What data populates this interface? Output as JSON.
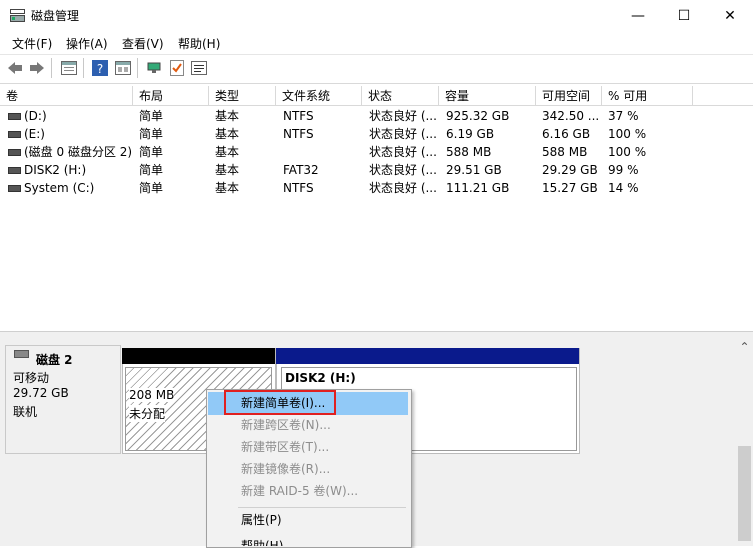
{
  "window": {
    "title": "磁盘管理",
    "minimize": "—",
    "maximize": "☐",
    "close": "✕"
  },
  "menubar": [
    "文件(F)",
    "操作(A)",
    "查看(V)",
    "帮助(H)"
  ],
  "toolbar": [
    "back-icon",
    "forward-icon",
    "panel-icon",
    "help-icon",
    "properties-icon",
    "connect-icon",
    "check-icon",
    "list-icon"
  ],
  "table": {
    "columns": [
      "卷",
      "布局",
      "类型",
      "文件系统",
      "状态",
      "容量",
      "可用空间",
      "% 可用"
    ],
    "rows": [
      [
        "(D:)",
        "简单",
        "基本",
        "NTFS",
        "状态良好 (...",
        "925.32 GB",
        "342.50 ...",
        "37 %"
      ],
      [
        "(E:)",
        "简单",
        "基本",
        "NTFS",
        "状态良好 (...",
        "6.19 GB",
        "6.16 GB",
        "100 %"
      ],
      [
        "(磁盘 0 磁盘分区 2)",
        "简单",
        "基本",
        "",
        "状态良好 (...",
        "588 MB",
        "588 MB",
        "100 %"
      ],
      [
        "DISK2 (H:)",
        "简单",
        "基本",
        "FAT32",
        "状态良好 (...",
        "29.51 GB",
        "29.29 GB",
        "99 %"
      ],
      [
        "System (C:)",
        "简单",
        "基本",
        "NTFS",
        "状态良好 (...",
        "111.21 GB",
        "15.27 GB",
        "14 %"
      ]
    ]
  },
  "disk": {
    "name": "磁盘 2",
    "type": "可移动",
    "size": "29.72 GB",
    "status": "联机",
    "unallocated_size": "208 MB",
    "unallocated_label": "未分配",
    "partition_name": "DISK2  (H:)"
  },
  "context_menu": {
    "items": [
      {
        "label": "新建简单卷(I)...",
        "enabled": true
      },
      {
        "label": "新建跨区卷(N)...",
        "enabled": false
      },
      {
        "label": "新建带区卷(T)...",
        "enabled": false
      },
      {
        "label": "新建镜像卷(R)...",
        "enabled": false
      },
      {
        "label": "新建 RAID-5 卷(W)...",
        "enabled": false
      },
      {
        "label": "属性(P)",
        "enabled": true
      },
      {
        "label": "帮助(H)",
        "enabled": true
      }
    ]
  },
  "scrollbar": {
    "up": "⌃"
  }
}
